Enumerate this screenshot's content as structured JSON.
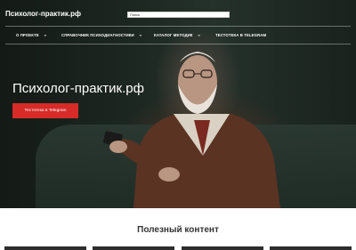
{
  "header": {
    "logo": "Психолог-практик.рф",
    "search": {
      "value": "Поиск",
      "placeholder": "Поиск"
    }
  },
  "nav": {
    "items": [
      {
        "label": "О проекте",
        "has_dropdown": true
      },
      {
        "label": "Справочник психодиагностики",
        "has_dropdown": true
      },
      {
        "label": "Каталог методик",
        "has_dropdown": true
      },
      {
        "label": "Тестотека в Telegram",
        "has_dropdown": false
      }
    ],
    "chevron": "⌄"
  },
  "hero": {
    "title": "Психолог-практик.рф",
    "button": "Тестотека в Telegram"
  },
  "section": {
    "title": "Полезный контент"
  },
  "colors": {
    "accent": "#d62b27",
    "text_dark": "#333333",
    "hero_dark": "#1c2621"
  }
}
